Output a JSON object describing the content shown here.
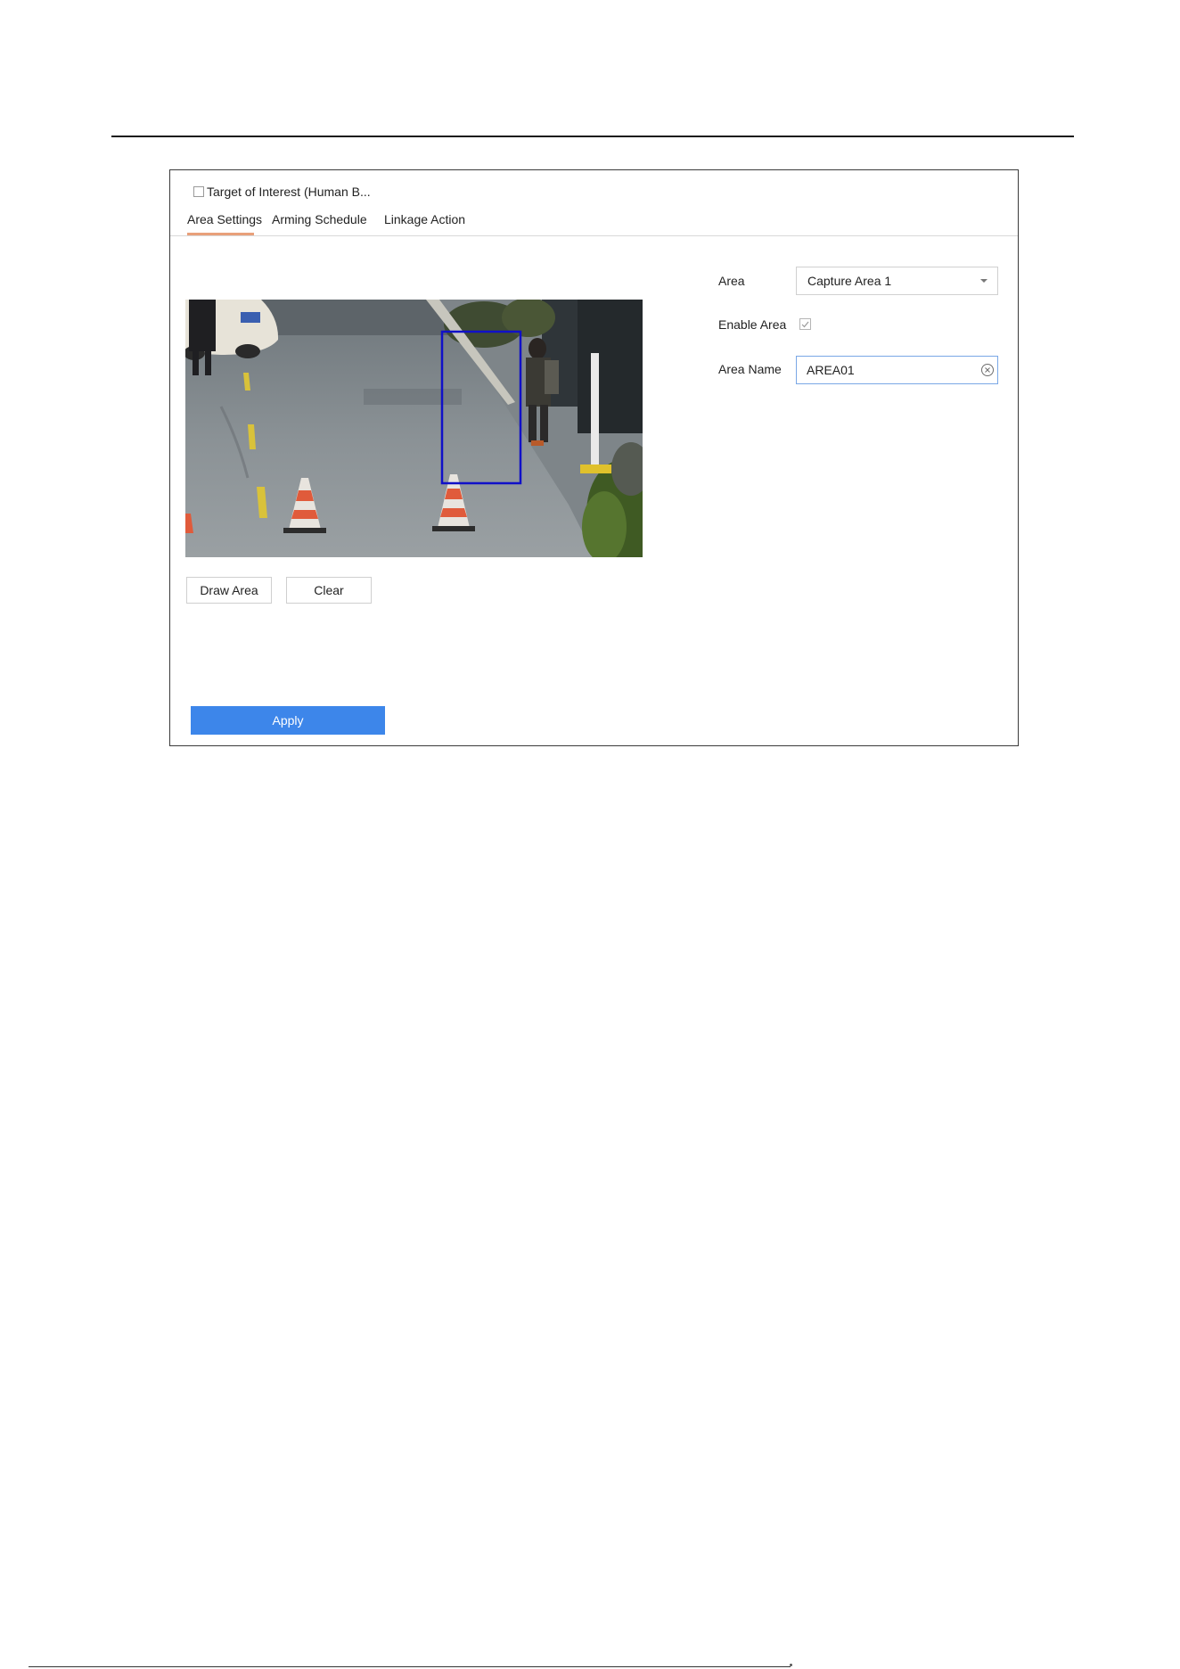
{
  "toi": {
    "label": "Target of Interest (Human B...",
    "checked": false
  },
  "tabs": [
    {
      "label": "Area Settings",
      "active": true
    },
    {
      "label": "Arming Schedule",
      "active": false
    },
    {
      "label": "Linkage Action",
      "active": false
    }
  ],
  "buttons": {
    "draw_area": "Draw Area",
    "clear": "Clear",
    "apply": "Apply"
  },
  "form": {
    "area_label": "Area",
    "area_value": "Capture Area 1",
    "enable_label": "Enable Area",
    "enable_checked": true,
    "name_label": "Area Name",
    "name_value": "AREA01"
  },
  "colors": {
    "accent": "#3d86ea",
    "tab_underline": "#e8a07a",
    "detection_box": "#1010c8"
  },
  "icons": {
    "dropdown": "chevron-down-icon",
    "clear_input": "clear-circle-icon",
    "checkbox": "checkbox-icon"
  }
}
